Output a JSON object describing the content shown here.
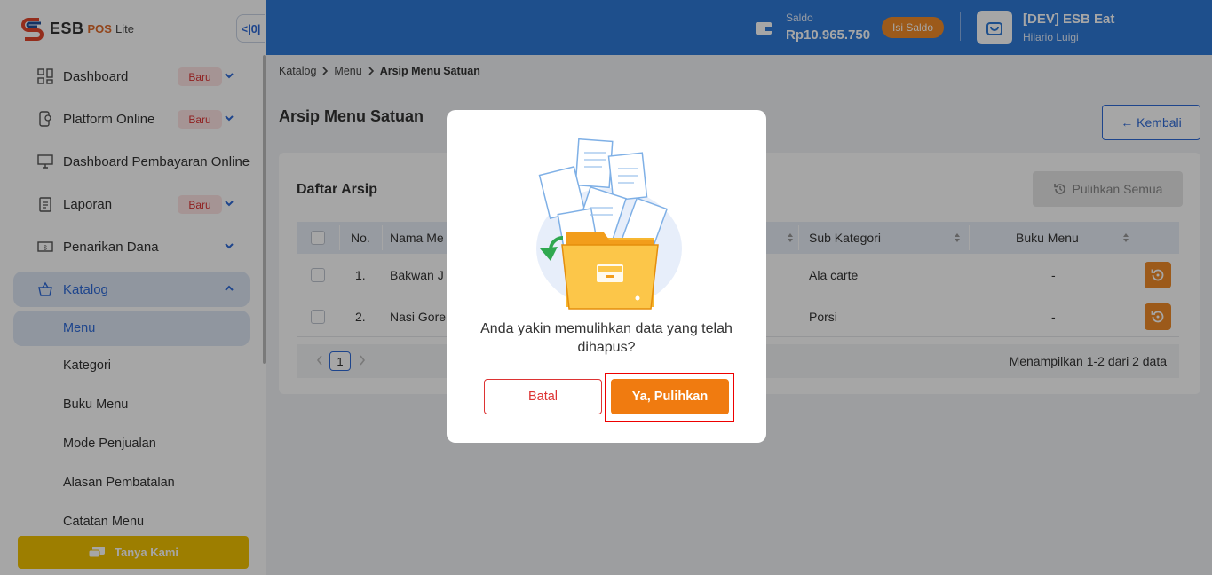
{
  "app": {
    "logo_main": "ESB",
    "logo_pos": "POS",
    "logo_lite": "Lite",
    "collapse_label": "<|0|"
  },
  "sidebar": {
    "items": [
      {
        "label": "Dashboard",
        "badge": "Baru"
      },
      {
        "label": "Platform Online",
        "badge": "Baru"
      },
      {
        "label": "Dashboard Pembayaran Online"
      },
      {
        "label": "Laporan",
        "badge": "Baru"
      },
      {
        "label": "Penarikan Dana"
      },
      {
        "label": "Katalog"
      }
    ],
    "subitems": [
      "Menu",
      "Kategori",
      "Buku Menu",
      "Mode Penjualan",
      "Alasan Pembatalan",
      "Catatan Menu"
    ],
    "help_label": "Tanya Kami"
  },
  "header": {
    "saldo_label": "Saldo",
    "saldo_value": "Rp10.965.750",
    "topup_label": "Isi Saldo",
    "store_name": "[DEV] ESB Eat",
    "user_name": "Hilario Luigi"
  },
  "breadcrumb": [
    "Katalog",
    "Menu",
    "Arsip Menu Satuan"
  ],
  "page": {
    "title": "Arsip Menu Satuan",
    "back_label": "← Kembali"
  },
  "card": {
    "title": "Daftar Arsip",
    "restore_all_label": "Pulihkan Semua",
    "columns": [
      "No.",
      "Nama Me",
      "Sub Kategori",
      "Buku Menu"
    ],
    "rows": [
      {
        "no": "1.",
        "name": "Bakwan J",
        "sub": "Ala carte",
        "book": "-"
      },
      {
        "no": "2.",
        "name": "Nasi Gore",
        "sub": "Porsi",
        "book": "-"
      }
    ],
    "pager": {
      "page": "1",
      "info": "Menampilkan 1-2 dari 2 data"
    }
  },
  "modal": {
    "message": "Anda yakin memulihkan data yang telah dihapus?",
    "cancel_label": "Batal",
    "confirm_label": "Ya, Pulihkan"
  },
  "colors": {
    "primary": "#2f7ad8",
    "accent": "#f07b10",
    "danger": "#dd3333"
  }
}
